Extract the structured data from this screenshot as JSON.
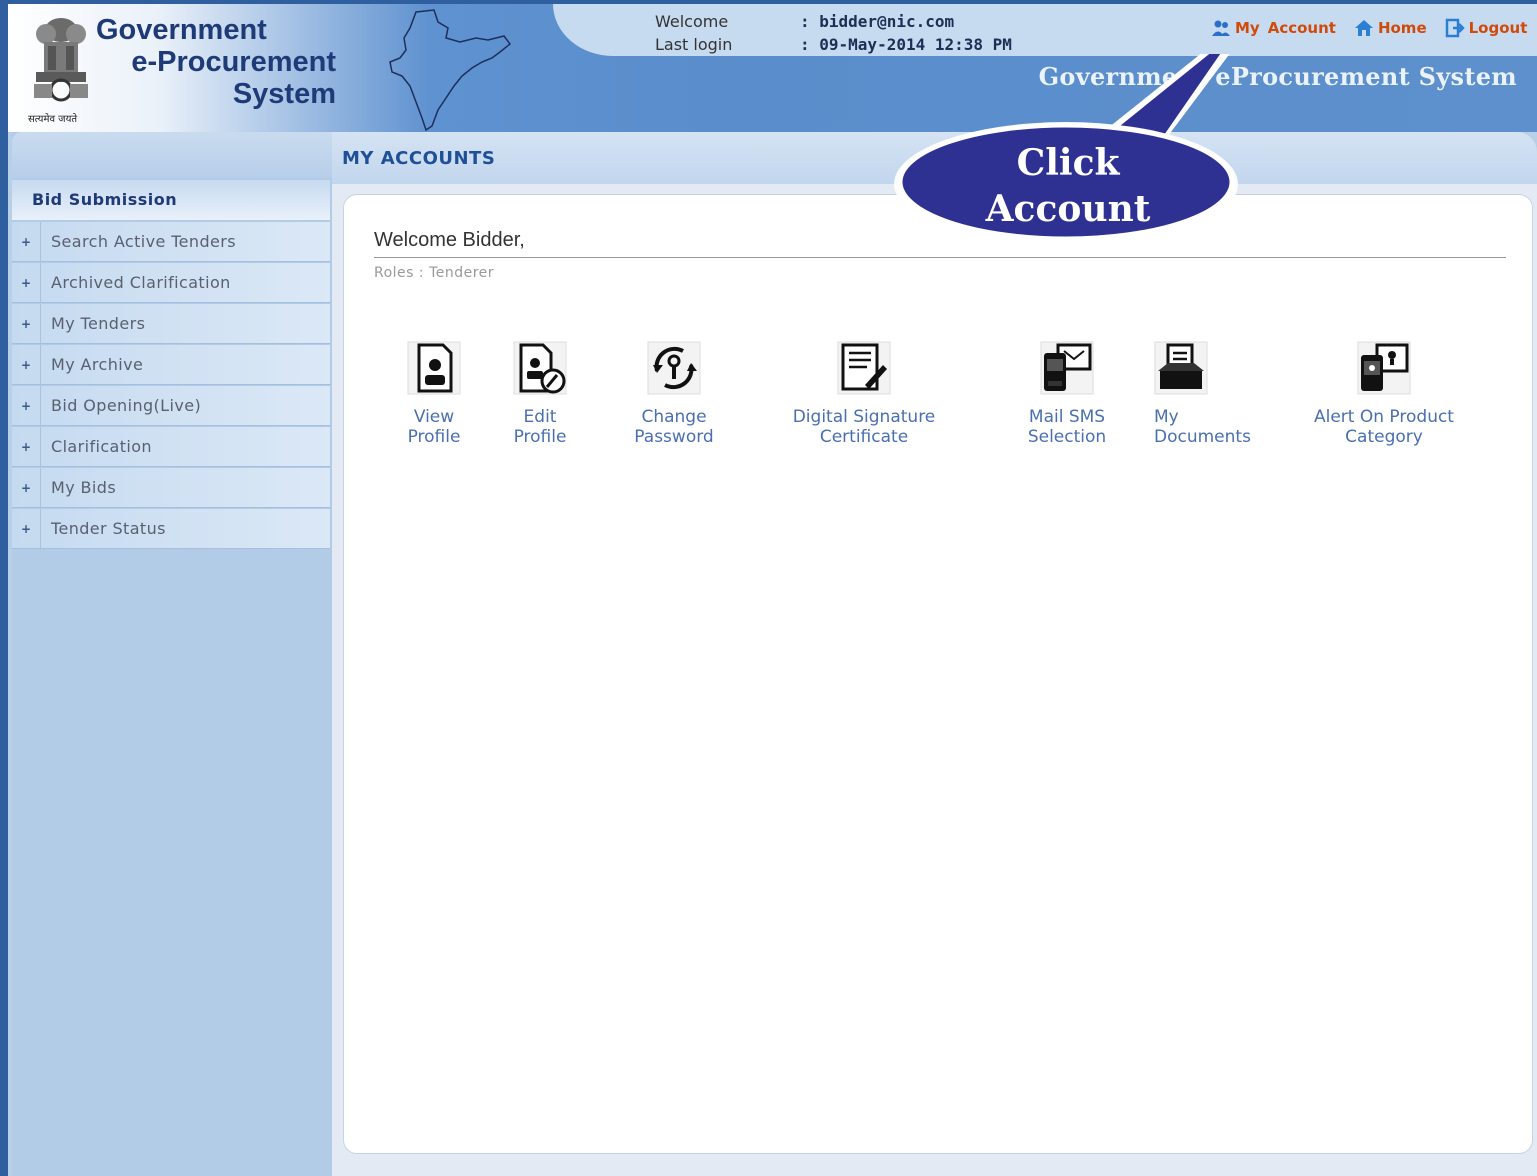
{
  "header": {
    "logo_line1": "Government",
    "logo_line2": "e-Procurement",
    "logo_line3": "System",
    "emblem_motto": "सत्यमेव जयते",
    "welcome_label": "Welcome",
    "welcome_value": ": bidder@nic.com",
    "last_login_label": "Last login",
    "last_login_value": ": 09-May-2014 12:38 PM",
    "links": {
      "my": "My",
      "account": "Account",
      "home": "Home",
      "logout": "Logout"
    },
    "system_title": "Government eProcurement System"
  },
  "sidebar": {
    "title": "Bid Submission",
    "items": [
      {
        "label": "Search Active Tenders"
      },
      {
        "label": "Archived Clarification"
      },
      {
        "label": "My Tenders"
      },
      {
        "label": "My Archive"
      },
      {
        "label": "Bid Opening(Live)"
      },
      {
        "label": "Clarification"
      },
      {
        "label": "My Bids"
      },
      {
        "label": "Tender Status"
      }
    ],
    "plus_glyph": "+"
  },
  "main": {
    "tab_title": "MY ACCOUNTS",
    "welcome": "Welcome Bidder,",
    "roles": "Roles : Tenderer",
    "actions": [
      {
        "line1": "View",
        "line2": "Profile",
        "icon": "view-profile-icon"
      },
      {
        "line1": "Edit",
        "line2": "Profile",
        "icon": "edit-profile-icon"
      },
      {
        "line1": "Change",
        "line2": "Password",
        "icon": "change-password-icon"
      },
      {
        "line1": "Digital Signature",
        "line2": "Certificate",
        "icon": "certificate-icon"
      },
      {
        "line1": "Mail SMS",
        "line2": "Selection",
        "icon": "mail-sms-icon"
      },
      {
        "line1": "My",
        "line2": "Documents",
        "icon": "documents-icon"
      },
      {
        "line1": "Alert On Product",
        "line2": "Category",
        "icon": "alert-icon"
      }
    ]
  },
  "callout": {
    "line1": "Click",
    "line2": "Account"
  },
  "colors": {
    "brand_blue": "#1e3b78",
    "link_orange": "#d04a0a",
    "callout_fill": "#2e3192"
  }
}
